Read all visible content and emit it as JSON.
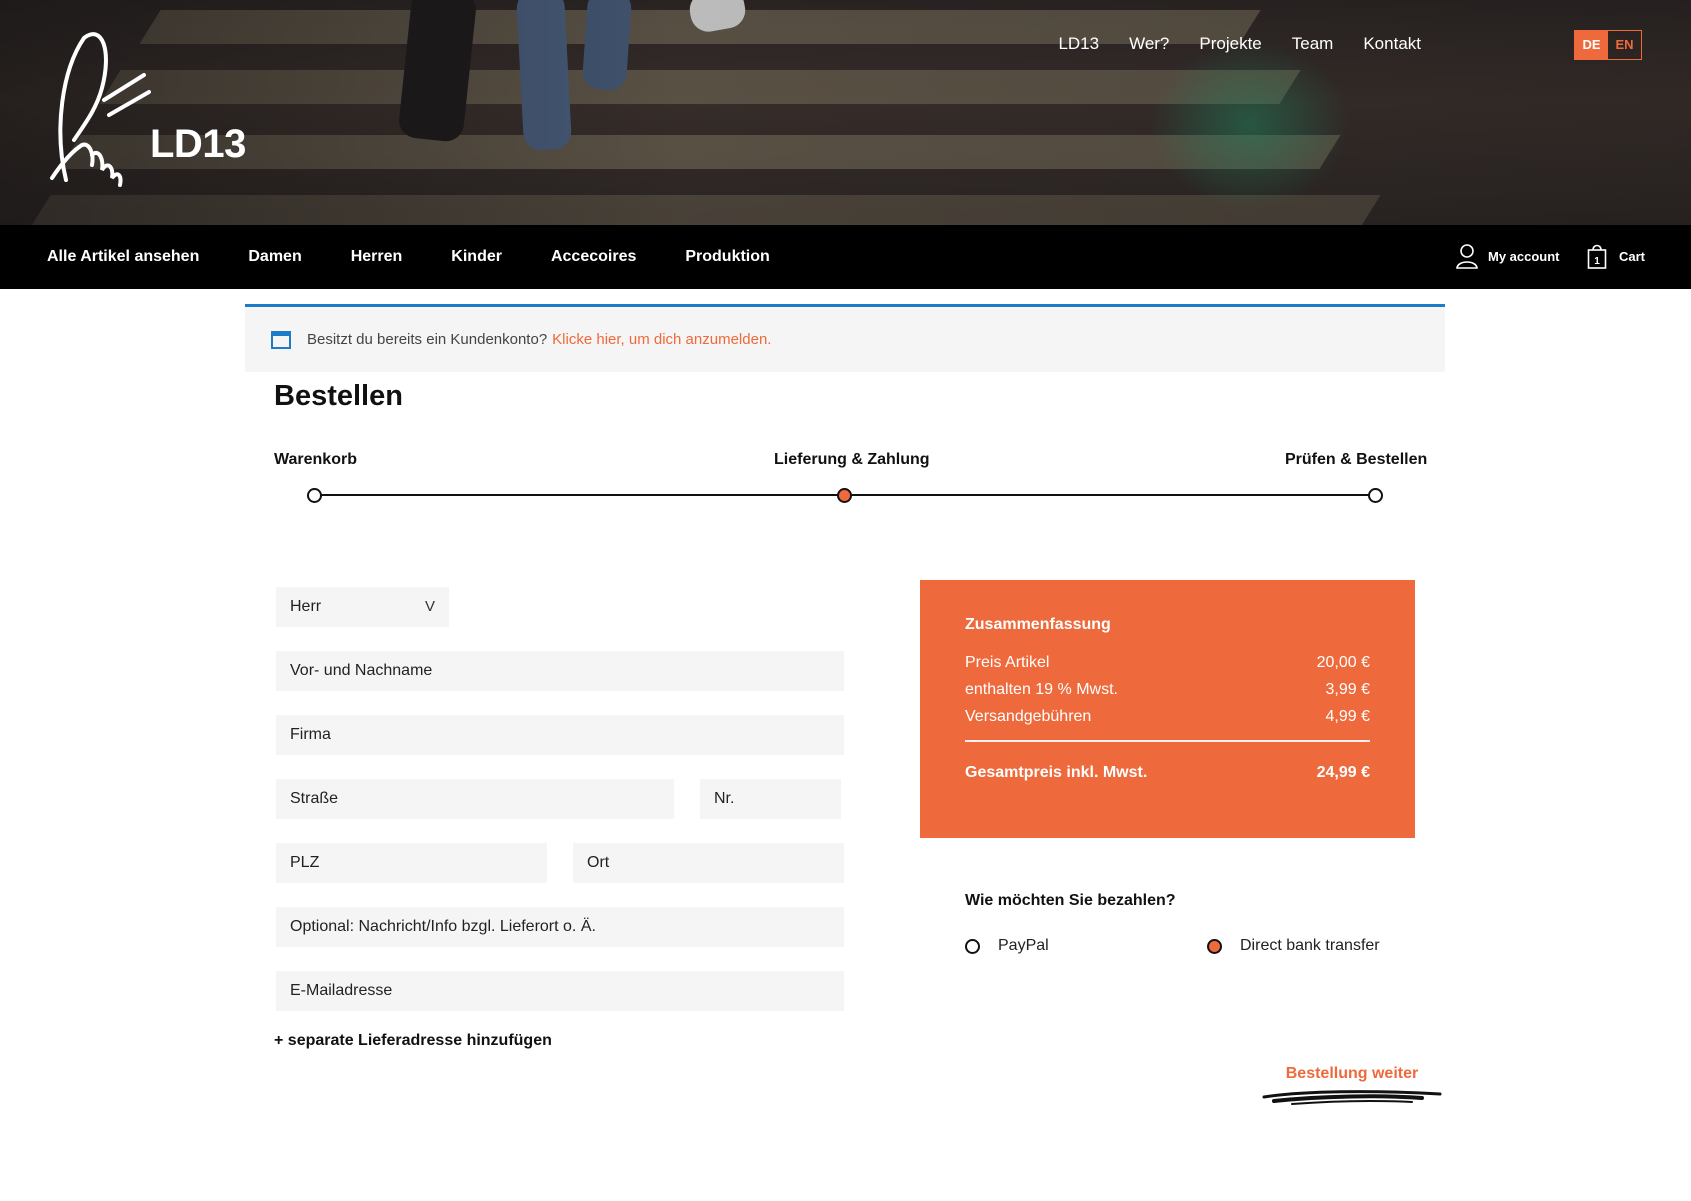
{
  "header": {
    "brand": "LD13",
    "topnav": [
      "LD13",
      "Wer?",
      "Projekte",
      "Team",
      "Kontakt"
    ],
    "lang": {
      "de": "DE",
      "en": "EN"
    }
  },
  "mainnav": {
    "categories": [
      "Alle Artikel ansehen",
      "Damen",
      "Herren",
      "Kinder",
      "Accecoires",
      "Produktion"
    ],
    "account": "My account",
    "cart": "Cart",
    "cart_count": "1"
  },
  "notice": {
    "text": "Besitzt du bereits ein Kundenkonto?",
    "link": "Klicke hier, um dich anzumelden."
  },
  "checkout": {
    "title": "Bestellen",
    "steps": [
      "Warenkorb",
      "Lieferung & Zahlung",
      "Prüfen & Bestellen"
    ],
    "active_step": 1
  },
  "form": {
    "salutation": "Herr",
    "name": "Vor- und Nachname",
    "company": "Firma",
    "street": "Straße",
    "number": "Nr.",
    "zip": "PLZ",
    "city": "Ort",
    "message": "Optional: Nachricht/Info bzgl. Lieferort o. Ä.",
    "email": "E-Mailadresse",
    "add_address": "+ separate Lieferadresse hinzufügen"
  },
  "summary": {
    "title": "Zusammenfassung",
    "rows": [
      {
        "label": "Preis Artikel",
        "value": "20,00 €"
      },
      {
        "label": "enthalten 19 % Mwst.",
        "value": "3,99 €"
      },
      {
        "label": "Versandgebühren",
        "value": "4,99 €"
      }
    ],
    "total_label": "Gesamtpreis inkl. Mwst.",
    "total_value": "24,99 €"
  },
  "payment": {
    "question": "Wie möchten Sie bezahlen?",
    "options": [
      "PayPal",
      "Direct bank transfer"
    ],
    "selected": "Direct bank transfer"
  },
  "cta": "Bestellung weiter",
  "colors": {
    "accent": "#ee6a3c",
    "notice_border": "#1e7bc6",
    "nav_bg": "#000000"
  }
}
